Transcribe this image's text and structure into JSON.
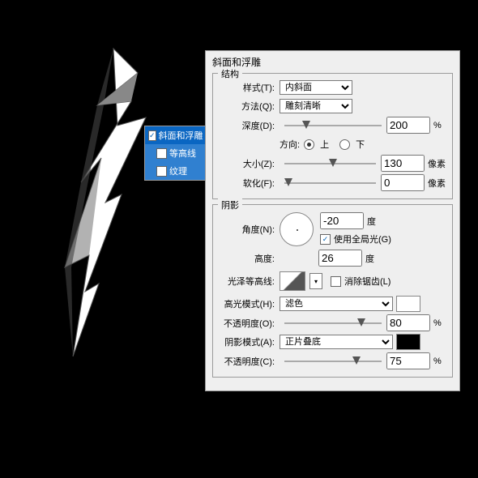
{
  "list": {
    "main": "斜面和浮雕",
    "sub1": "等高线",
    "sub2": "纹理"
  },
  "panel_title": "斜面和浮雕",
  "grp1": {
    "hdr": "结构",
    "style_lbl": "样式(T):",
    "style": "内斜面",
    "tech_lbl": "方法(Q):",
    "tech": "雕刻清晰",
    "depth_lbl": "深度(D):",
    "depth": "200",
    "pct": "%",
    "dir_lbl": "方向:",
    "up": "上",
    "down": "下",
    "size_lbl": "大小(Z):",
    "size": "130",
    "px": "像素",
    "soft_lbl": "软化(F):",
    "soft": "0"
  },
  "grp2": {
    "hdr": "阴影",
    "angle_lbl": "角度(N):",
    "angle": "-20",
    "deg": "度",
    "global": "使用全局光(G)",
    "alt_lbl": "高度:",
    "alt": "26",
    "contour_lbl": "光泽等高线:",
    "anti": "消除锯齿(L)",
    "hl_lbl": "高光模式(H):",
    "hl": "滤色",
    "hlop_lbl": "不透明度(O):",
    "hlop": "80",
    "sh_lbl": "阴影模式(A):",
    "sh": "正片叠底",
    "shop_lbl": "不透明度(C):",
    "shop": "75"
  }
}
